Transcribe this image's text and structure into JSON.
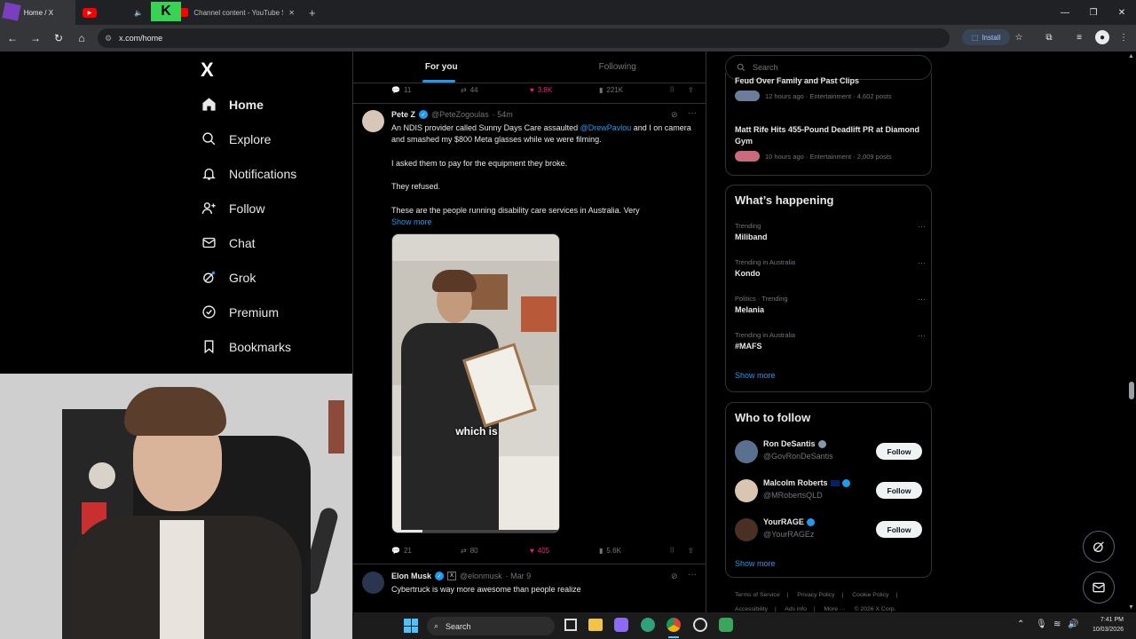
{
  "browser": {
    "tabs": [
      {
        "label": "Home / X",
        "active": true
      },
      {
        "label": "",
        "active": false
      },
      {
        "label": "Channel content - YouTube Studio",
        "active": false
      }
    ],
    "new_tab": "+",
    "url": "x.com/home",
    "install_label": "Install"
  },
  "x": {
    "logo": "X",
    "nav": [
      {
        "label": "Home",
        "icon": "home-icon"
      },
      {
        "label": "Explore",
        "icon": "search-icon"
      },
      {
        "label": "Notifications",
        "icon": "bell-icon"
      },
      {
        "label": "Follow",
        "icon": "person-plus-icon"
      },
      {
        "label": "Chat",
        "icon": "mail-icon"
      },
      {
        "label": "Grok",
        "icon": "grok-icon"
      },
      {
        "label": "Premium",
        "icon": "premium-icon"
      },
      {
        "label": "Bookmarks",
        "icon": "bookmark-icon"
      }
    ],
    "feed_tabs": [
      "For you",
      "Following"
    ],
    "prev_stats": {
      "replies": "11",
      "reposts": "44",
      "likes": "3.8K",
      "views": "221K"
    },
    "tweet1": {
      "name": "Pete Z",
      "handle": "@PeteZogoulas",
      "time": "· 54m",
      "line1_pre": "An NDIS provider called Sunny Days Care assaulted ",
      "line1_mention": "@DrewPavlou",
      "line1_post": " and I on camera and smashed my $800 Meta glasses while we were filming.",
      "p2": "I asked them to pay for the equipment they broke.",
      "p3": "They refused.",
      "p4": "These are the people running disability care services in Australia. Very",
      "show_more": "Show more",
      "caption": "which is",
      "stats": {
        "replies": "21",
        "reposts": "80",
        "likes": "405",
        "views": "5.6K"
      }
    },
    "tweet2": {
      "name": "Elon Musk",
      "handle": "@elonmusk",
      "time": "· Mar 9",
      "text": "Cybertruck is way more awesome than people realize"
    },
    "search_placeholder": "Search",
    "news": [
      {
        "title": "Feud Over Family and Past Clips",
        "meta": "12 hours ago · Entertainment · 4,602 posts"
      },
      {
        "title": "Matt Rife Hits 455-Pound Deadlift PR at Diamond Gym",
        "meta": "10 hours ago · Entertainment · 2,009 posts"
      }
    ],
    "happening": {
      "title": "What’s happening",
      "items": [
        {
          "meta": "Trending",
          "name": "Miliband"
        },
        {
          "meta": "Trending in Australia",
          "name": "Kondo"
        },
        {
          "meta": "Politics · Trending",
          "name": "Melania"
        },
        {
          "meta": "Trending in Australia",
          "name": "#MAFS"
        }
      ],
      "show_more": "Show more"
    },
    "who_to_follow": {
      "title": "Who to follow",
      "users": [
        {
          "name": "Ron DeSantis",
          "handle": "@GovRonDeSantis",
          "button": "Follow"
        },
        {
          "name": "Malcolm Roberts",
          "handle": "@MRobertsQLD",
          "button": "Follow"
        },
        {
          "name": "YourRAGE",
          "handle": "@YourRAGEz",
          "button": "Follow"
        }
      ],
      "show_more": "Show more"
    },
    "footer": [
      "Terms of Service",
      "|",
      "Privacy Policy",
      "|",
      "Cookie Policy",
      "|",
      "Accessibility",
      "|",
      "Ads info",
      "|",
      "More ···",
      "© 2026 X Corp."
    ]
  },
  "taskbar": {
    "search": "Search",
    "time": "7:41 PM",
    "date": "10/03/2026"
  },
  "colors": {
    "accent": "#1d9bf0",
    "like": "#f91880",
    "bg": "#000000"
  }
}
